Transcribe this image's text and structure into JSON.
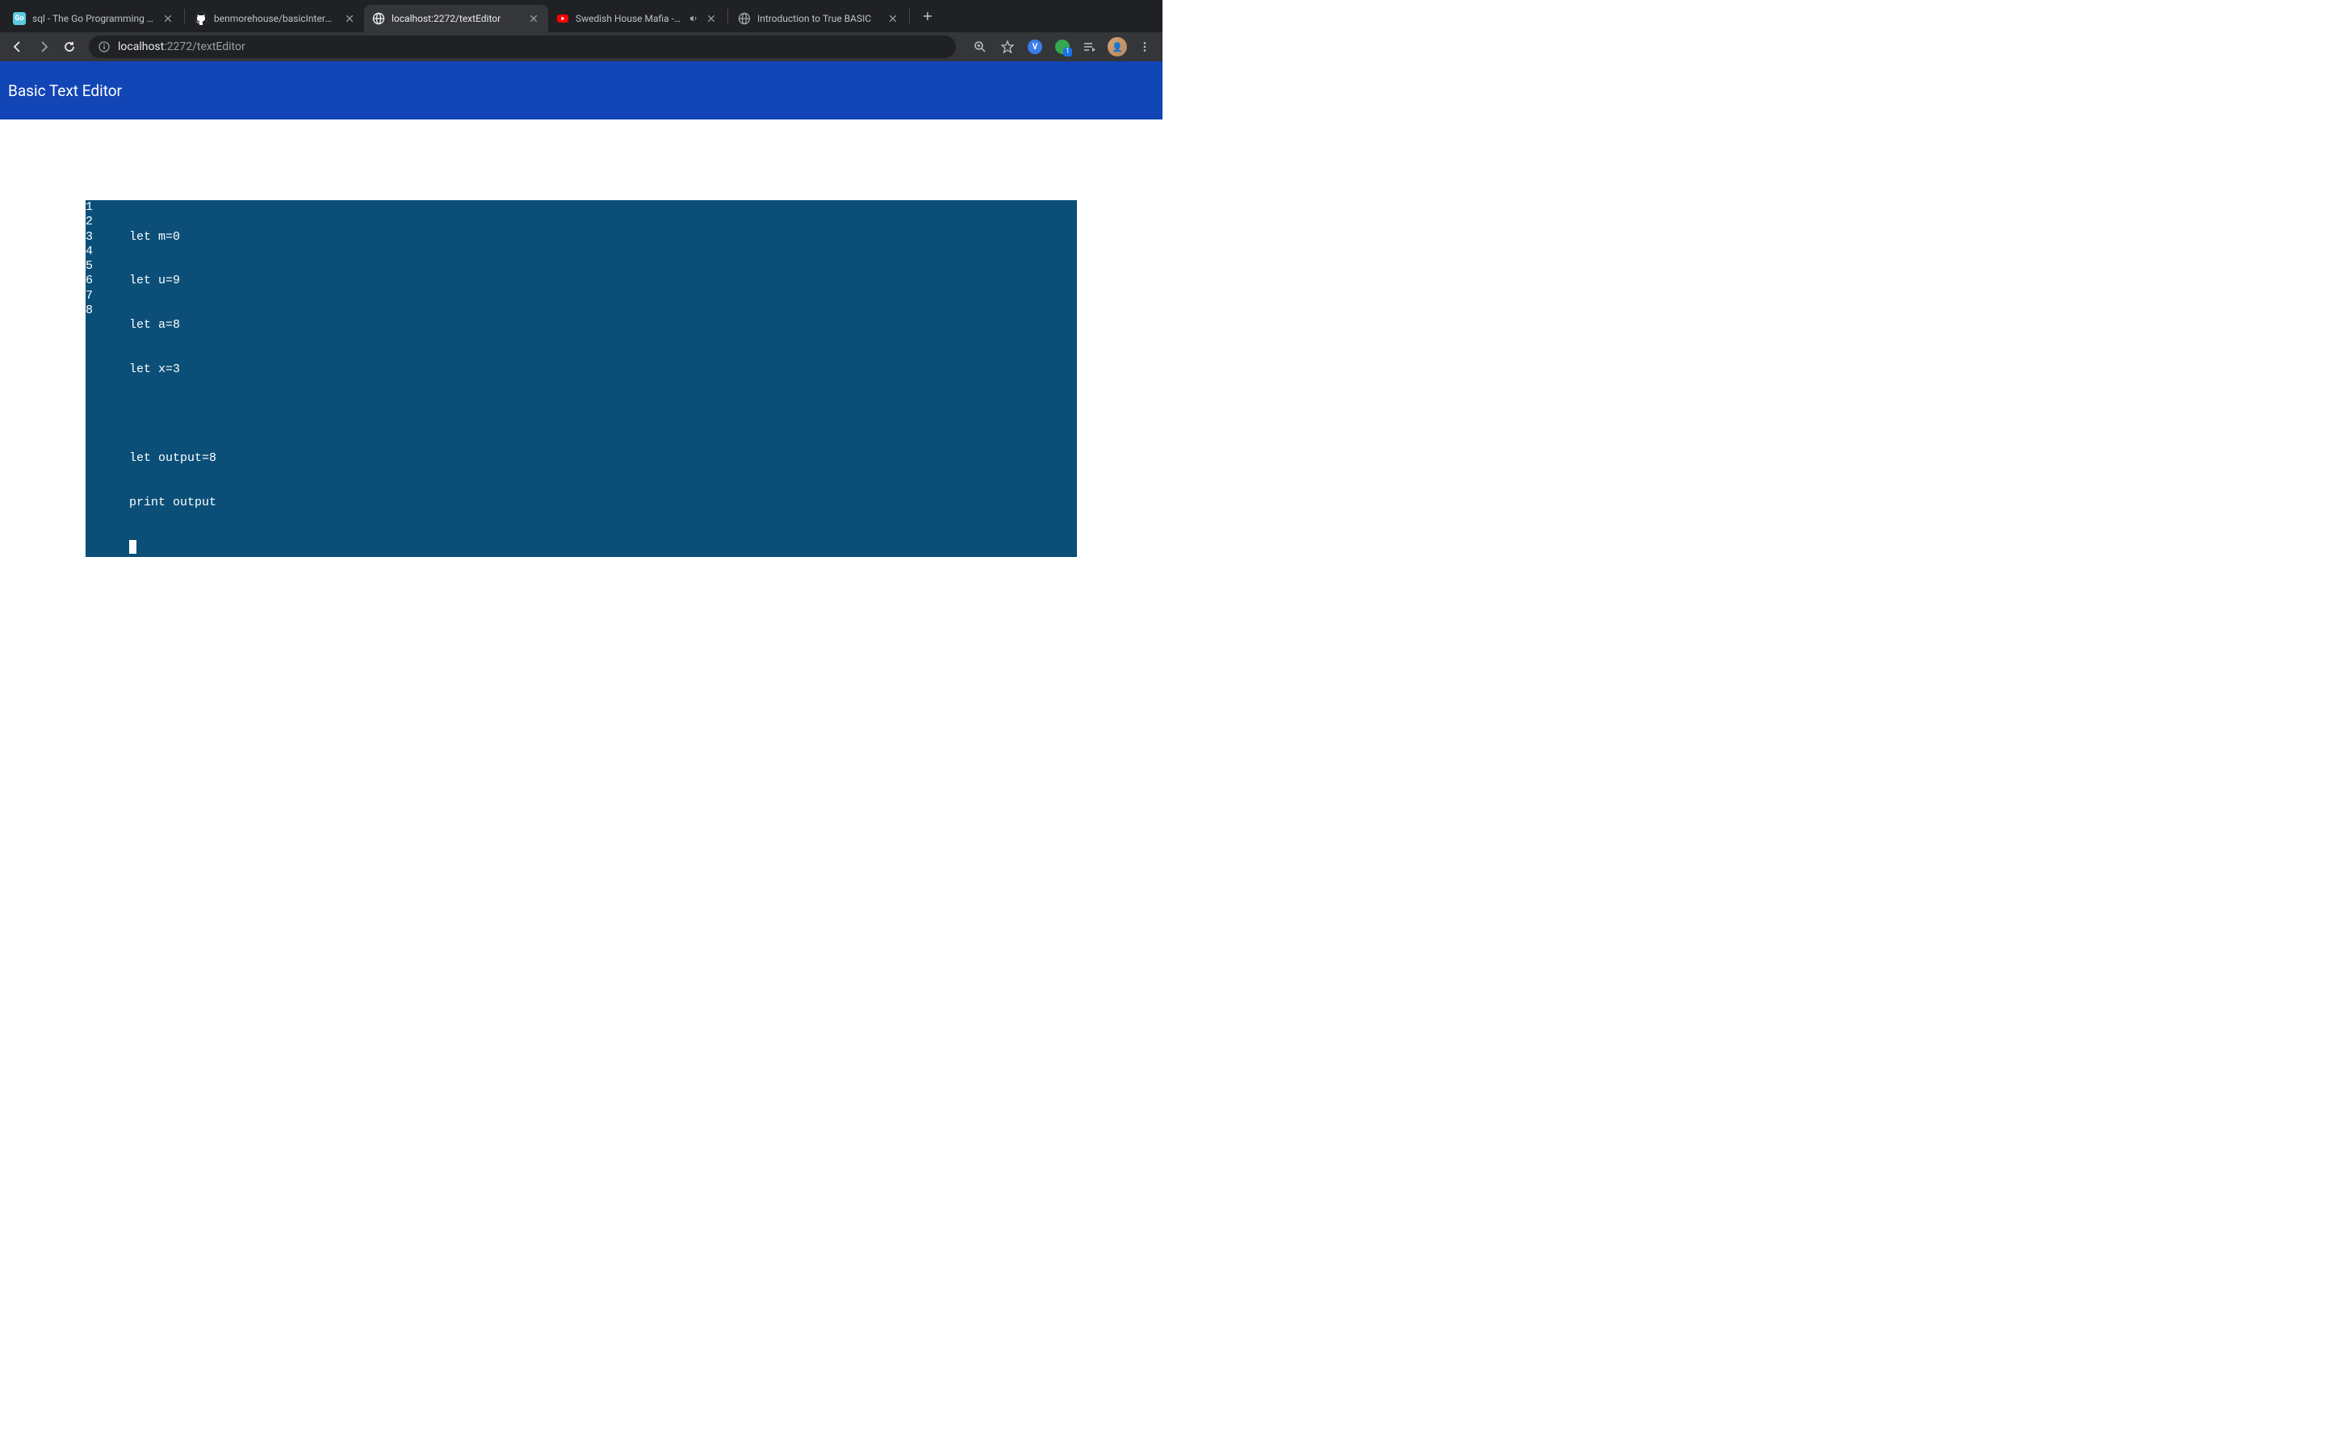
{
  "browser": {
    "tabs": [
      {
        "title": "sql - The Go Programming Lan",
        "favicon": "go"
      },
      {
        "title": "benmorehouse/basicInterprete",
        "favicon": "github"
      },
      {
        "title": "localhost:2272/textEditor",
        "favicon": "globe",
        "active": true
      },
      {
        "title": "Swedish House Mafia - Do",
        "favicon": "youtube",
        "audio": true
      },
      {
        "title": "Introduction to True BASIC",
        "favicon": "globe-grey"
      }
    ],
    "url_host": "localhost",
    "url_port": ":2272",
    "url_path": "/textEditor",
    "ext_badge": "1"
  },
  "page": {
    "title": "Basic Text Editor"
  },
  "editor": {
    "lines": [
      "let m=0",
      "let u=9",
      "let a=8",
      "let x=3",
      "",
      "let output=8",
      "print output",
      ""
    ],
    "line_numbers": [
      "1",
      "2",
      "3",
      "4",
      "5",
      "6",
      "7",
      "8"
    ]
  }
}
